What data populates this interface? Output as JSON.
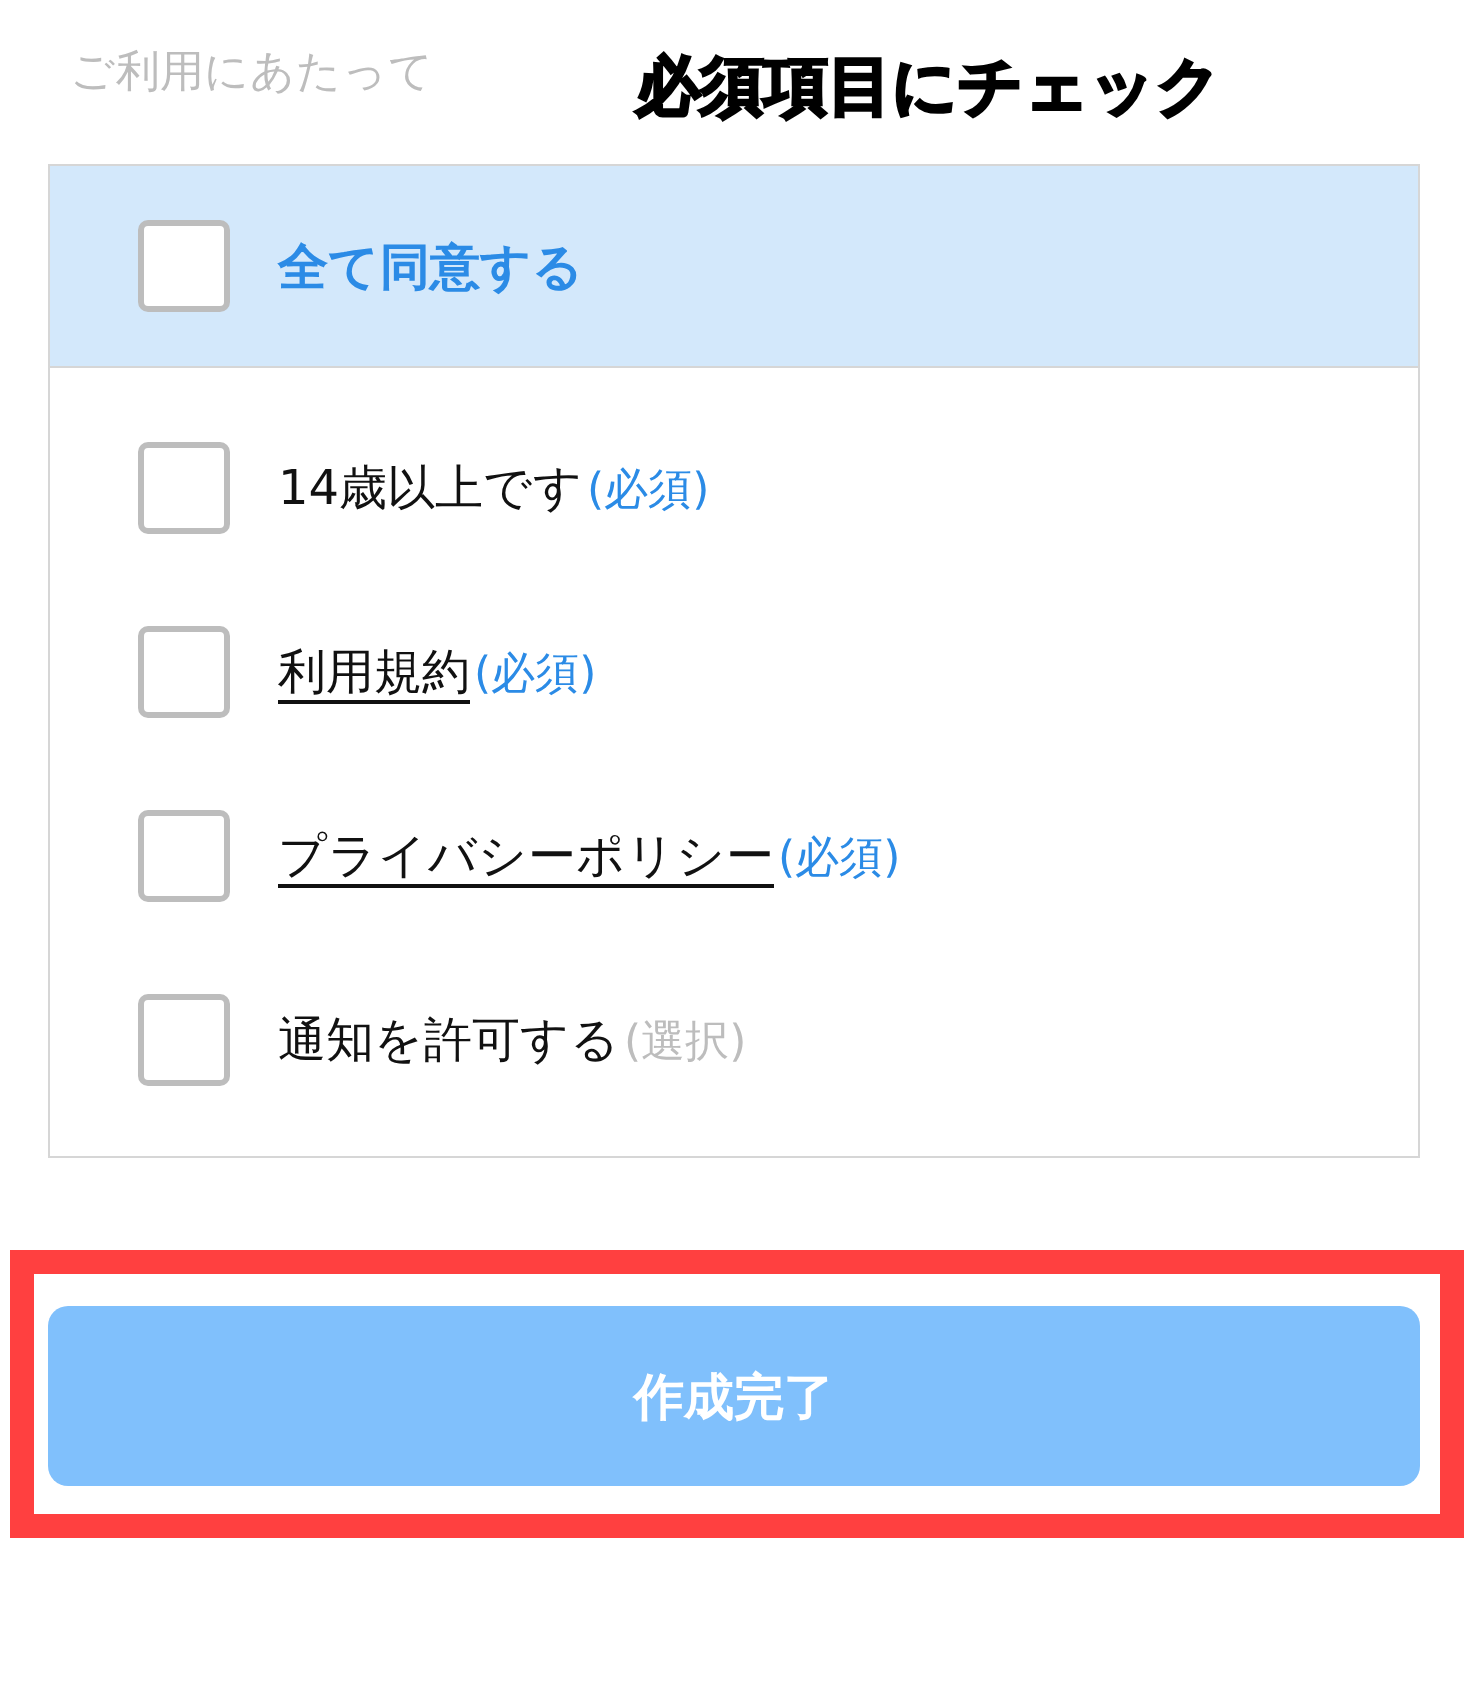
{
  "section_title": "ご利用にあたって",
  "annotation": {
    "text": "必須項目にチェック"
  },
  "agree_all": {
    "label": "全て同意する",
    "checked": false
  },
  "items": [
    {
      "label": "14歳以上です",
      "link": false,
      "tag": "(必須)",
      "kind": "required",
      "checked": false
    },
    {
      "label": "利用規約",
      "link": true,
      "tag": "(必須)",
      "kind": "required",
      "checked": false
    },
    {
      "label": "プライバシーポリシー",
      "link": true,
      "tag": "(必須)",
      "kind": "required",
      "checked": false
    },
    {
      "label": "通知を許可する",
      "link": false,
      "tag": "(選択)",
      "kind": "optional",
      "checked": false
    }
  ],
  "submit": {
    "label": "作成完了",
    "disabled": true,
    "highlighted": true
  }
}
